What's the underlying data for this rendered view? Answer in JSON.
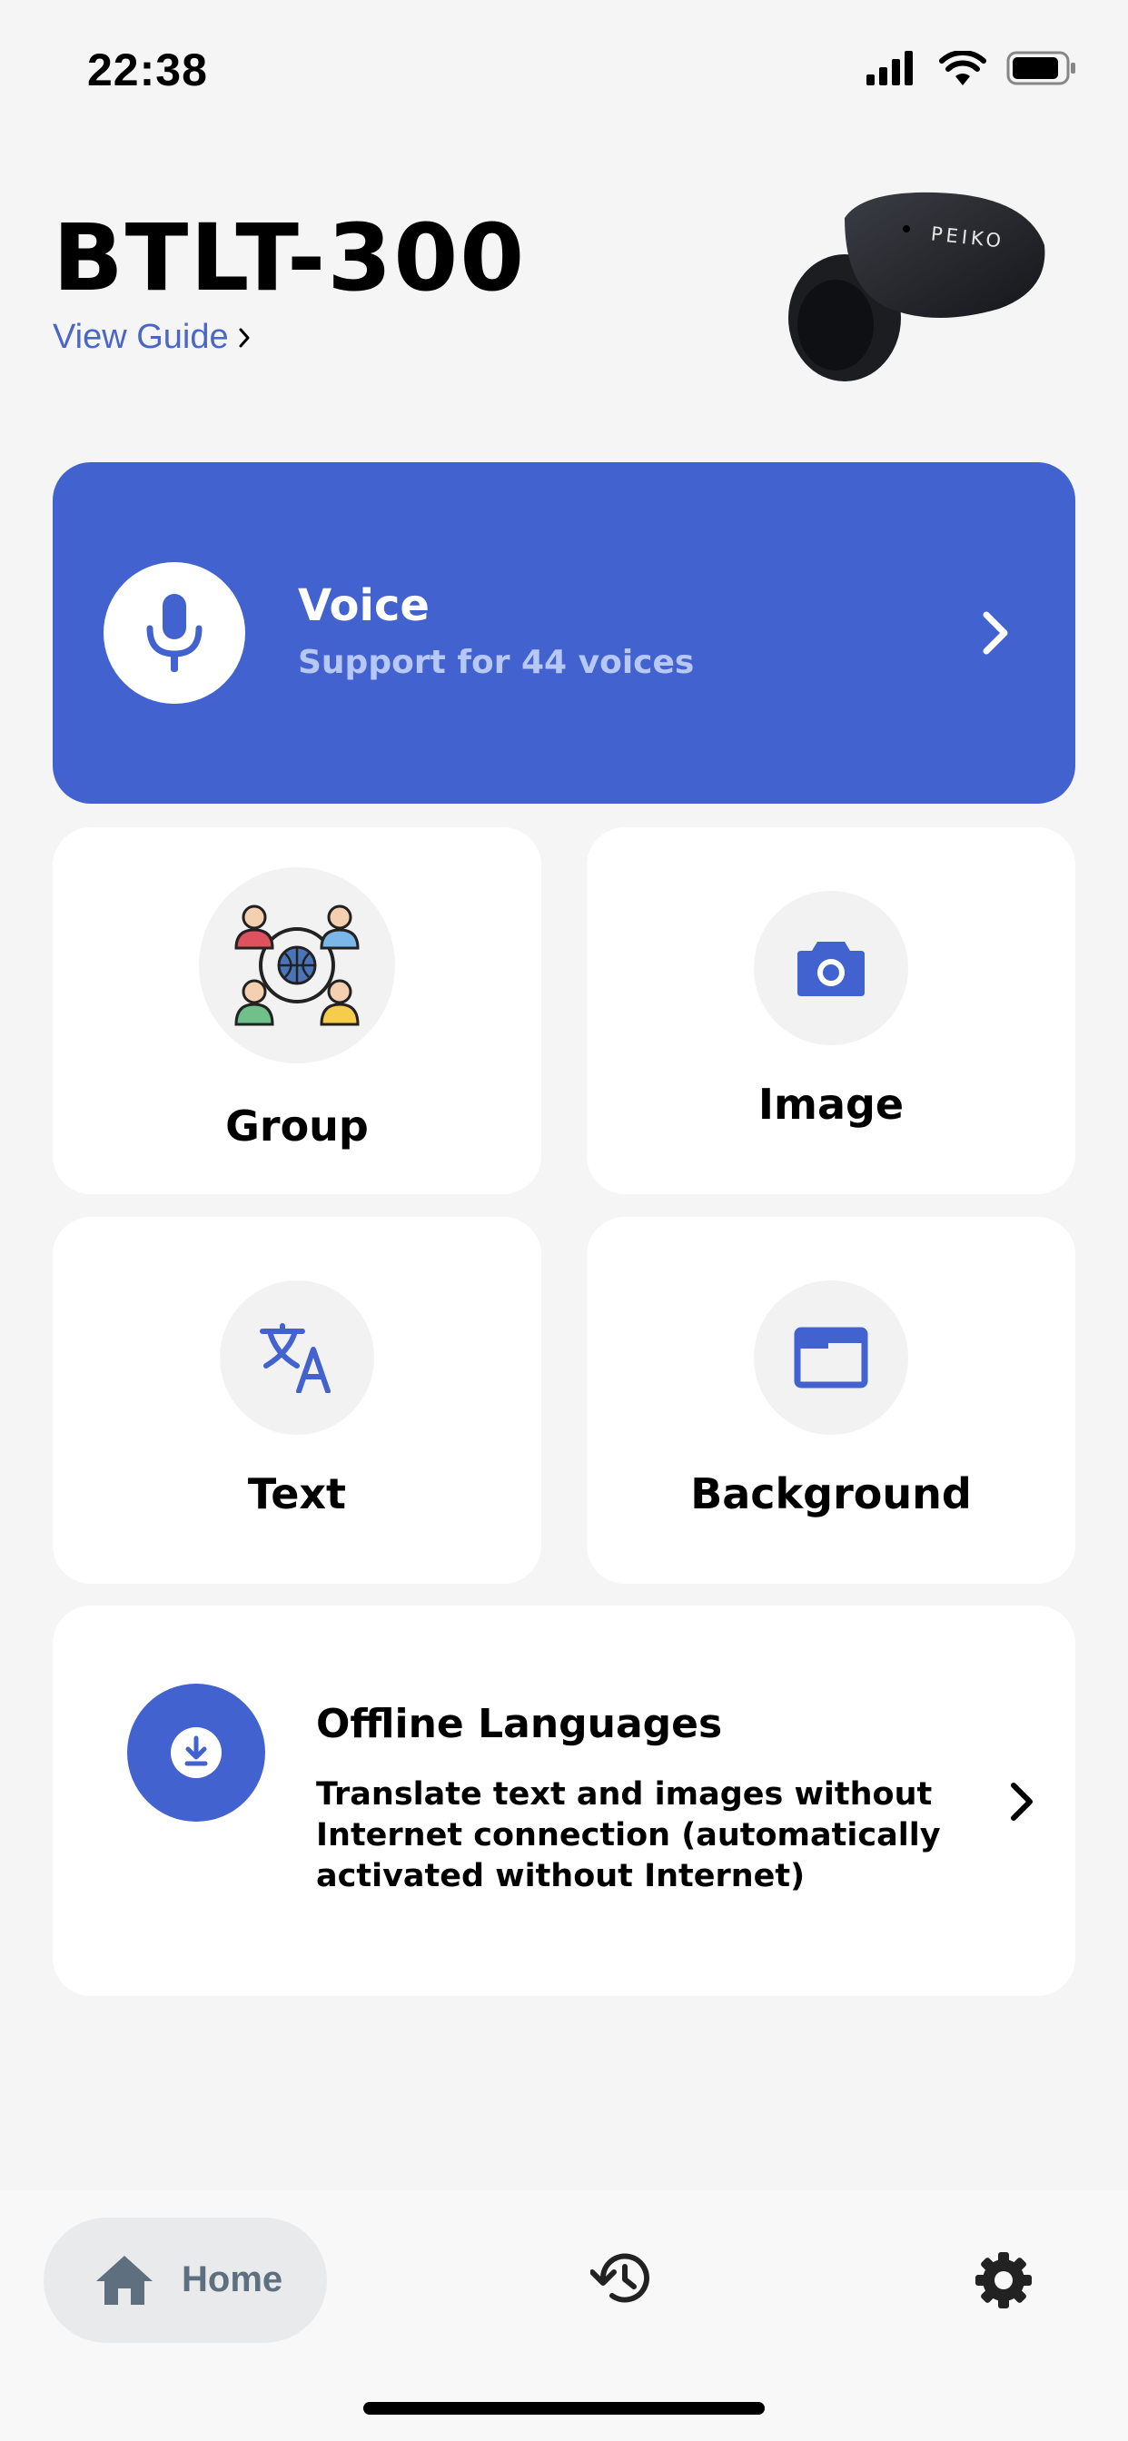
{
  "status_bar": {
    "time": "22:38",
    "icons": [
      "signal-icon",
      "wifi-icon",
      "battery-icon"
    ]
  },
  "header": {
    "device_name": "BTLT-300",
    "guide_link": "View Guide",
    "brand_on_image": "PEIKO"
  },
  "voice_card": {
    "title": "Voice",
    "subtitle": "Support for 44 voices",
    "icon": "microphone-icon"
  },
  "tiles": [
    {
      "label": "Group",
      "icon": "group-globe-icon"
    },
    {
      "label": "Image",
      "icon": "camera-icon"
    },
    {
      "label": "Text",
      "icon": "translate-icon"
    },
    {
      "label": "Background",
      "icon": "window-icon"
    }
  ],
  "offline_card": {
    "title": "Offline Languages",
    "description": "Translate text and images without Internet connection (automatically activated without Internet)",
    "icon": "download-icon"
  },
  "tab_bar": {
    "home_label": "Home",
    "items": [
      "home-icon",
      "history-icon",
      "settings-icon"
    ]
  },
  "colors": {
    "accent": "#4262cf",
    "background": "#f5f5f6",
    "link": "#4a67c8",
    "voice_subtitle": "#b8c8f5"
  }
}
